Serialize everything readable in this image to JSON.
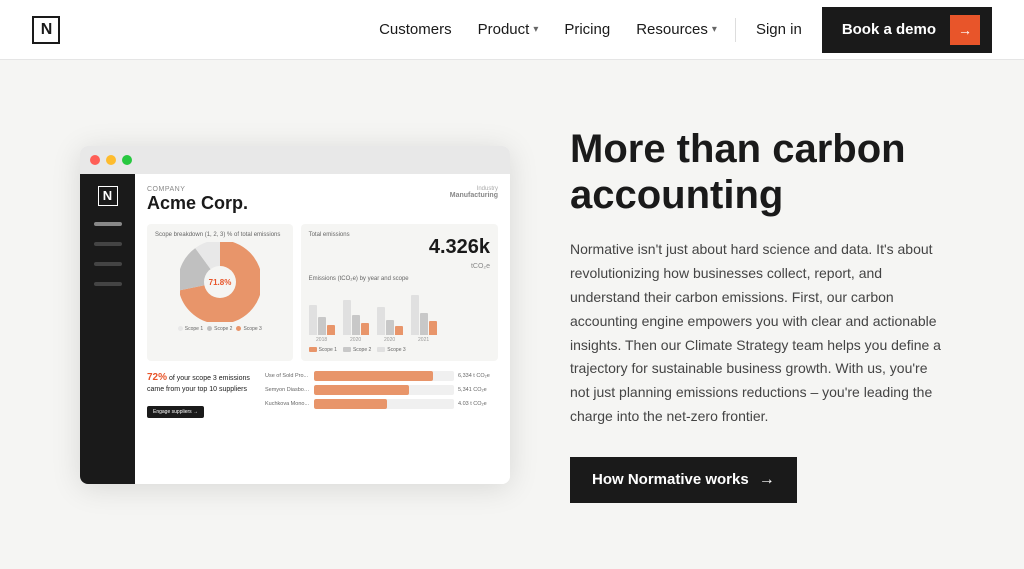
{
  "navbar": {
    "logo_text": "N",
    "links": [
      {
        "id": "customers",
        "label": "Customers",
        "has_dropdown": false
      },
      {
        "id": "product",
        "label": "Product",
        "has_dropdown": true
      },
      {
        "id": "pricing",
        "label": "Pricing",
        "has_dropdown": false
      },
      {
        "id": "resources",
        "label": "Resources",
        "has_dropdown": true
      }
    ],
    "signin_label": "Sign in",
    "cta_label": "Book a demo",
    "cta_arrow": "→"
  },
  "dashboard": {
    "company_label": "Company",
    "company_name": "Acme Corp.",
    "industry_label": "Industry",
    "industry_value": "Manufacturing",
    "scope_card_title": "Scope breakdown (1, 2, 3) % of total emissions",
    "emissions_card_title": "Total emissions",
    "emissions_unit": "tCO₂e",
    "emissions_value": "4.326k",
    "bar_chart_title": "Emissions (tCO₂e) by year and scope",
    "bar_years": [
      "2018",
      "2019",
      "2020",
      "2021"
    ],
    "suppliers_highlight": "72%",
    "suppliers_text": " of your scope 3 emissions came from your top 10 suppliers",
    "engage_label": "Engage suppliers →",
    "hbars": [
      {
        "label": "Use of Sold Pro...",
        "value_text": "6,334 t CO₂e",
        "pct": 85
      },
      {
        "label": "Semyon Diasbou...",
        "value_text": "5,341 CO₂e",
        "pct": 68
      },
      {
        "label": "Kuchkova Mono...",
        "value_text": "4.03 t CO₂e",
        "pct": 52
      }
    ]
  },
  "hero": {
    "heading_line1": "More than carbon",
    "heading_line2": "accounting",
    "description": "Normative isn't just about hard science and data. It's about revolutionizing how businesses collect, report, and understand their carbon emissions. First, our carbon accounting engine empowers you with clear and actionable insights. Then our Climate Strategy team helps you define a trajectory for sustainable business growth. With us, you're not just planning emissions reductions – you're leading the charge into the net-zero frontier.",
    "cta_label": "How Normative works",
    "cta_arrow": "→"
  },
  "colors": {
    "accent_orange": "#e8552a",
    "bar_scope1": "#e8956a",
    "bar_scope2": "#c0c0c0",
    "bar_scope3": "#e0e0e0",
    "pie_main": "#e8956a",
    "pie_secondary": "#c0c0c0",
    "pie_tertiary": "#e8e8e8"
  }
}
